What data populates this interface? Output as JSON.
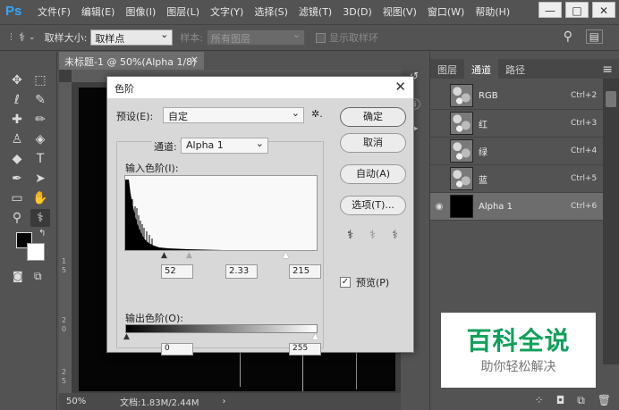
{
  "app": {
    "logo": "Ps"
  },
  "menu": [
    "文件(F)",
    "编辑(E)",
    "图像(I)",
    "图层(L)",
    "文字(Y)",
    "选择(S)",
    "滤镜(T)",
    "3D(D)",
    "视图(V)",
    "窗口(W)",
    "帮助(H)"
  ],
  "window_controls": {
    "minimize": "—",
    "restore": "□",
    "close": "✕"
  },
  "options_bar": {
    "sample_size_label": "取样大小:",
    "sample_size_value": "取样点",
    "sample_label": "样本:",
    "sample_value": "所有图层",
    "show_ring_label": "显示取样环"
  },
  "document": {
    "tab_title": "未标题-1 @ 50%(Alpha 1/8) *",
    "tab_close": "×",
    "zoom": "50%",
    "doc_info": "文档:1.83M/2.44M",
    "status_arrow": "›"
  },
  "ruler_left_marks": [
    "1",
    "5",
    "2",
    "0",
    "2",
    "5"
  ],
  "tools": [
    {
      "name": "move-tool",
      "glyph": "✥"
    },
    {
      "name": "marquee-tool",
      "glyph": "⬚"
    },
    {
      "name": "lasso-tool",
      "glyph": "ℓ"
    },
    {
      "name": "quick-select-tool",
      "glyph": "✎"
    },
    {
      "name": "healing-brush-tool",
      "glyph": "✚"
    },
    {
      "name": "brush-tool",
      "glyph": "✏"
    },
    {
      "name": "stamp-tool",
      "glyph": "♙"
    },
    {
      "name": "eraser-tool",
      "glyph": "◈"
    },
    {
      "name": "paint-bucket-tool",
      "glyph": "◆"
    },
    {
      "name": "type-tool",
      "glyph": "T"
    },
    {
      "name": "pen-tool",
      "glyph": "✒"
    },
    {
      "name": "path-select-tool",
      "glyph": "➤"
    },
    {
      "name": "shape-tool",
      "glyph": "▭"
    },
    {
      "name": "hand-tool",
      "glyph": "✋"
    },
    {
      "name": "zoom-tool",
      "glyph": "⚲"
    },
    {
      "name": "eyedropper-tool",
      "glyph": "⚕"
    }
  ],
  "channels_panel": {
    "tabs": [
      "图层",
      "通道",
      "路径"
    ],
    "active_tab": 1,
    "menu_icon": "≡",
    "channels": [
      {
        "name": "RGB",
        "shortcut": "Ctrl+2",
        "thumb": "noise",
        "visible": false
      },
      {
        "name": "红",
        "shortcut": "Ctrl+3",
        "thumb": "noise",
        "visible": false
      },
      {
        "name": "绿",
        "shortcut": "Ctrl+4",
        "thumb": "noise",
        "visible": false
      },
      {
        "name": "蓝",
        "shortcut": "Ctrl+5",
        "thumb": "noise",
        "visible": false
      },
      {
        "name": "Alpha 1",
        "shortcut": "Ctrl+6",
        "thumb": "black",
        "visible": true
      }
    ],
    "bottom_icons": [
      "⁘",
      "◘",
      "⧉",
      "🗑"
    ]
  },
  "watermark": {
    "title": "百科全说",
    "subtitle": "助你轻松解决"
  },
  "levels_dialog": {
    "title": "色阶",
    "close": "✕",
    "preset_label": "预设(E):",
    "preset_value": "自定",
    "preset_menu_icon": "✲.",
    "channel_label": "通道:",
    "channel_value": "Alpha 1",
    "input_levels_label": "输入色阶(I):",
    "input_black": "52",
    "input_gamma": "2.33",
    "input_white": "215",
    "output_levels_label": "输出色阶(O):",
    "output_black": "0",
    "output_white": "255",
    "buttons": {
      "ok": "确定",
      "cancel": "取消",
      "auto": "自动(A)",
      "options": "选项(T)..."
    },
    "preview_label": "预览(P)",
    "preview_checked": true
  }
}
